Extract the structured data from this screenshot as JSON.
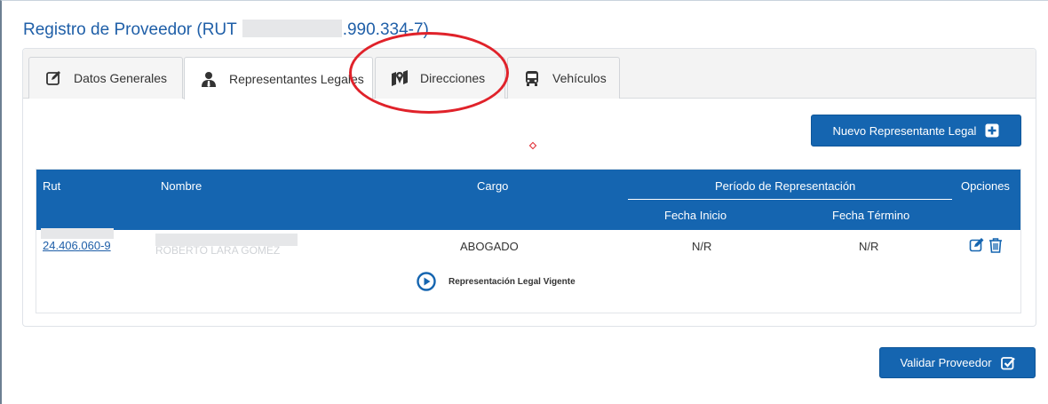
{
  "page": {
    "title_prefix": "Registro de Proveedor (RUT ",
    "title_suffix": ".990.334-7)"
  },
  "tabs": [
    {
      "label": "Datos Generales",
      "icon": "edit-icon"
    },
    {
      "label": "Representantes Legales",
      "icon": "user-tie-icon"
    },
    {
      "label": "Direcciones",
      "icon": "map-marker-icon"
    },
    {
      "label": "Vehículos",
      "icon": "bus-icon"
    }
  ],
  "actions": {
    "new_rep_label": "Nuevo Representante Legal",
    "validate_label": "Validar Proveedor"
  },
  "table": {
    "headers": {
      "rut": "Rut",
      "nombre": "Nombre",
      "cargo": "Cargo",
      "periodo": "Período de Representación",
      "opciones": "Opciones",
      "fecha_inicio": "Fecha Inicio",
      "fecha_termino": "Fecha Término"
    },
    "rows": [
      {
        "rut": "24.406.060-9",
        "nombre": "ROBERTO LARA GOMEZ",
        "cargo": "ABOGADO",
        "fecha_inicio": "N/R",
        "fecha_termino": "N/R",
        "status": "Representación Legal Vigente"
      }
    ]
  },
  "colors": {
    "primary": "#1565b0",
    "title": "#1f5fa8",
    "highlight": "#e0222a"
  }
}
